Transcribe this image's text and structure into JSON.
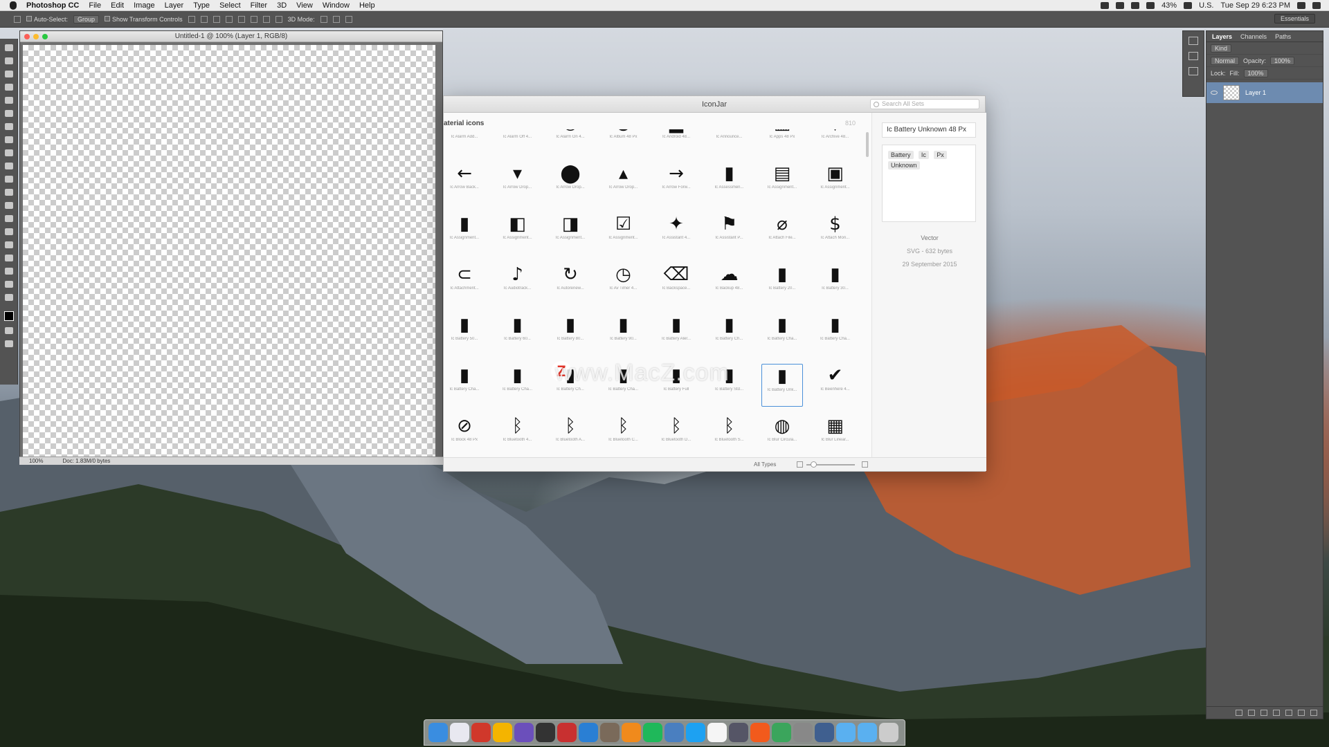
{
  "menubar": {
    "app": "Photoshop CC",
    "items": [
      "File",
      "Edit",
      "Image",
      "Layer",
      "Type",
      "Select",
      "Filter",
      "3D",
      "View",
      "Window",
      "Help"
    ],
    "battery": "43%",
    "input_source": "U.S.",
    "clock": "Tue Sep 29  6:23 PM"
  },
  "options_bar": {
    "auto_select": "Auto-Select:",
    "auto_select_value": "Group",
    "show_transform": "Show Transform Controls",
    "mode_3d": "3D Mode:",
    "workspace": "Essentials"
  },
  "document": {
    "title": "Untitled-1 @ 100% (Layer 1, RGB/8)",
    "zoom": "100%",
    "doc_size": "Doc: 1.83M/0 bytes"
  },
  "iconjar": {
    "title": "IconJar",
    "search_placeholder": "Search All Sets",
    "set_name": "aterial icons",
    "set_count": "810",
    "icons": [
      {
        "label": "Ic Alarm Add...",
        "glyph": "⊕"
      },
      {
        "label": "Ic Alarm Off 4...",
        "glyph": "⊘"
      },
      {
        "label": "Ic Alarm On 4...",
        "glyph": "◔"
      },
      {
        "label": "Ic Album 48 Px",
        "glyph": "●"
      },
      {
        "label": "Ic Android 48...",
        "glyph": "▟"
      },
      {
        "label": "Ic Announce...",
        "glyph": "▬"
      },
      {
        "label": "Ic Apps 48 Px",
        "glyph": "▦"
      },
      {
        "label": "Ic Archive 48...",
        "glyph": "▼"
      },
      {
        "label": "Ic Arrow Back...",
        "glyph": "←"
      },
      {
        "label": "Ic Arrow Drop...",
        "glyph": "▾"
      },
      {
        "label": "Ic Arrow Drop...",
        "glyph": "⬤"
      },
      {
        "label": "Ic Arrow Drop...",
        "glyph": "▴"
      },
      {
        "label": "Ic Arrow Forw...",
        "glyph": "→"
      },
      {
        "label": "Ic Assessmen...",
        "glyph": "▮"
      },
      {
        "label": "Ic Assignment...",
        "glyph": "▤"
      },
      {
        "label": "Ic Assignment...",
        "glyph": "▣"
      },
      {
        "label": "Ic Assignment...",
        "glyph": "▮"
      },
      {
        "label": "Ic Assignment...",
        "glyph": "◧"
      },
      {
        "label": "Ic Assignment...",
        "glyph": "◨"
      },
      {
        "label": "Ic Assignment...",
        "glyph": "☑"
      },
      {
        "label": "Ic Assistant 4...",
        "glyph": "✦"
      },
      {
        "label": "Ic Assistant P...",
        "glyph": "⚑"
      },
      {
        "label": "Ic Attach File...",
        "glyph": "⌀"
      },
      {
        "label": "Ic Attach Mon...",
        "glyph": "$"
      },
      {
        "label": "Ic Attachment...",
        "glyph": "⊂"
      },
      {
        "label": "Ic Audiotrack...",
        "glyph": "♪"
      },
      {
        "label": "Ic Autorenew...",
        "glyph": "↻"
      },
      {
        "label": "Ic Av Timer 4...",
        "glyph": "◷"
      },
      {
        "label": "Ic Backspace...",
        "glyph": "⌫"
      },
      {
        "label": "Ic Backup 48...",
        "glyph": "☁"
      },
      {
        "label": "Ic Battery 20...",
        "glyph": "▮"
      },
      {
        "label": "Ic Battery 30...",
        "glyph": "▮"
      },
      {
        "label": "Ic Battery 50...",
        "glyph": "▮"
      },
      {
        "label": "Ic Battery 60...",
        "glyph": "▮"
      },
      {
        "label": "Ic Battery 80...",
        "glyph": "▮"
      },
      {
        "label": "Ic Battery 90...",
        "glyph": "▮"
      },
      {
        "label": "Ic Battery Aler...",
        "glyph": "▮"
      },
      {
        "label": "Ic Battery Ch...",
        "glyph": "▮"
      },
      {
        "label": "Ic Battery Cha...",
        "glyph": "▮"
      },
      {
        "label": "Ic Battery Cha...",
        "glyph": "▮"
      },
      {
        "label": "Ic Battery Cha...",
        "glyph": "▮"
      },
      {
        "label": "Ic Battery Cha...",
        "glyph": "▮"
      },
      {
        "label": "Ic Battery Ch...",
        "glyph": "▮"
      },
      {
        "label": "Ic Battery Cha...",
        "glyph": "▮"
      },
      {
        "label": "Ic Battery Full",
        "glyph": "▮"
      },
      {
        "label": "Ic Battery Std...",
        "glyph": "▮"
      },
      {
        "label": "Ic Battery Unk...",
        "glyph": "▮"
      },
      {
        "label": "Ic Beenhere 4...",
        "glyph": "✔"
      },
      {
        "label": "Ic Block 48 Px",
        "glyph": "⊘"
      },
      {
        "label": "Ic Bluetooth 4...",
        "glyph": "ᛒ"
      },
      {
        "label": "Ic Bluetooth A...",
        "glyph": "ᛒ"
      },
      {
        "label": "Ic Bluetooth C...",
        "glyph": "ᛒ"
      },
      {
        "label": "Ic Bluetooth D...",
        "glyph": "ᛒ"
      },
      {
        "label": "Ic Bluetooth S...",
        "glyph": "ᛒ"
      },
      {
        "label": "Ic Blur Circula...",
        "glyph": "◍"
      },
      {
        "label": "Ic Blur Linear...",
        "glyph": "▦"
      }
    ],
    "detail": {
      "name": "Ic Battery Unknown 48 Px",
      "tags": [
        "Battery",
        "Ic",
        "Px",
        "Unknown"
      ],
      "kind": "Vector",
      "size": "SVG - 632 bytes",
      "date": "29 September 2015"
    },
    "footer": {
      "types": "All Types"
    }
  },
  "layers_panel": {
    "tabs": [
      "Layers",
      "Channels",
      "Paths"
    ],
    "kind": "Kind",
    "blend": "Normal",
    "opacity_label": "Opacity:",
    "opacity": "100%",
    "lock_label": "Lock:",
    "fill_label": "Fill:",
    "fill": "100%",
    "layer_name": "Layer 1"
  },
  "watermark": "www.MacZ.com",
  "colors": {
    "accent": "#4a90d9",
    "selection": "#6d8bb0"
  }
}
